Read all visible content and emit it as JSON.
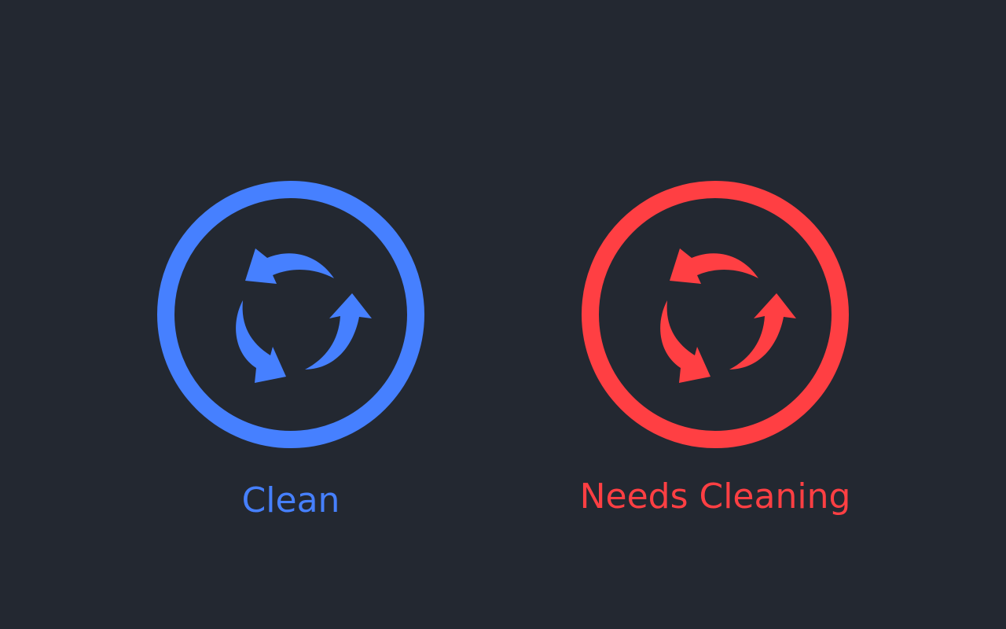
{
  "statuses": [
    {
      "label": "Clean",
      "color": "#4680ff",
      "icon": "recycle-arrows-icon"
    },
    {
      "label": "Needs Cleaning",
      "color": "#ff3f43",
      "icon": "recycle-arrows-icon"
    }
  ],
  "background": "#232831"
}
